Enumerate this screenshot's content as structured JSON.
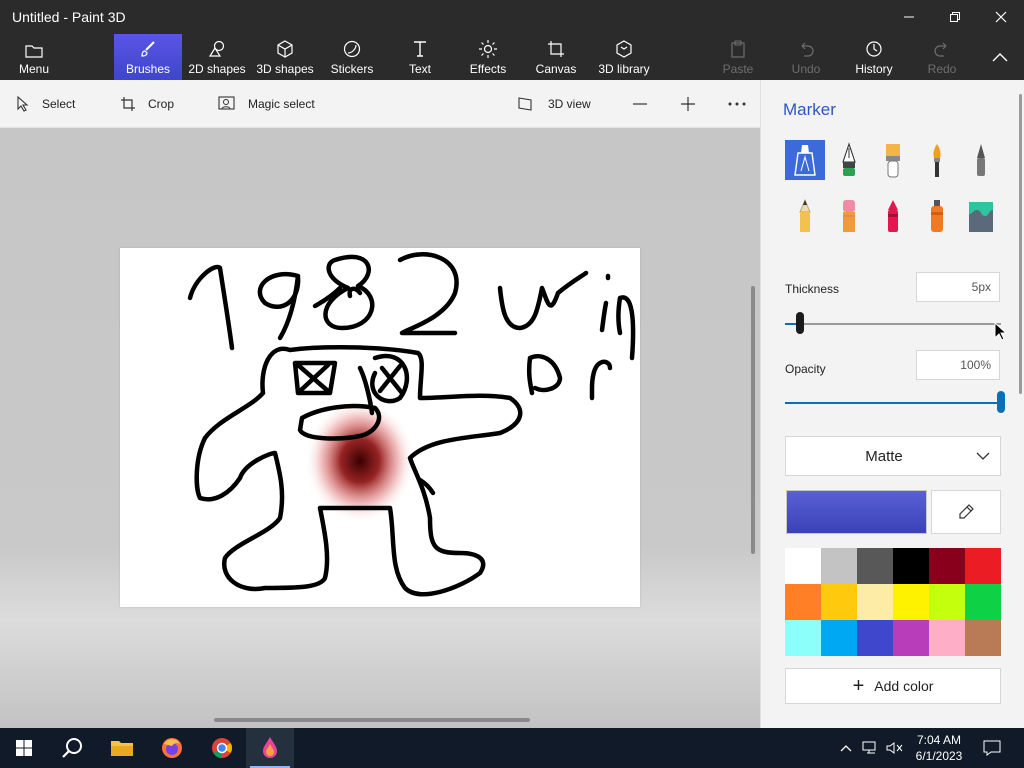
{
  "window": {
    "title": "Untitled - Paint 3D"
  },
  "ribbon": {
    "menu_label": "Menu",
    "tabs": [
      "Brushes",
      "2D shapes",
      "3D shapes",
      "Stickers",
      "Text",
      "Effects",
      "Canvas",
      "3D library"
    ],
    "actions": [
      "Paste",
      "Undo",
      "History",
      "Redo"
    ]
  },
  "toolbar": {
    "select": "Select",
    "crop": "Crop",
    "magic_select": "Magic select",
    "view3d": "3D view"
  },
  "panel": {
    "title": "Marker",
    "brushes": [
      "marker-icon",
      "calligraphy-pen-icon",
      "oil-brush-icon",
      "watercolor-icon",
      "pixel-pen-icon",
      "pencil-icon",
      "eraser-icon",
      "crayon-icon",
      "spray-can-icon",
      "fill-icon"
    ],
    "thickness_label": "Thickness",
    "thickness_value": "5px",
    "thickness_level": 0.05,
    "opacity_label": "Opacity",
    "opacity_value": "100%",
    "opacity_level": 1.0,
    "finish": "Matte",
    "current_color": "#3e44c0",
    "palette": [
      "#ffffff",
      "#c3c3c3",
      "#585858",
      "#000000",
      "#88001b",
      "#ec1c24",
      "#ff7f27",
      "#ffc90e",
      "#fdeca6",
      "#fff200",
      "#c4ff0e",
      "#0ed145",
      "#8cfffb",
      "#00a8f3",
      "#3f48cc",
      "#b83dba",
      "#ffaec8",
      "#b97a56"
    ],
    "add_color": "Add color",
    "accent": "#2f55c8"
  },
  "canvas_drawing": {
    "text_strokes": [
      "1982",
      "Win",
      "Dr"
    ]
  },
  "taskbar": {
    "apps": [
      "windows-start-icon",
      "search-icon",
      "file-explorer-icon",
      "firefox-icon",
      "chrome-icon",
      "paint-3d-icon"
    ],
    "time": "7:04 AM",
    "date": "6/1/2023"
  }
}
